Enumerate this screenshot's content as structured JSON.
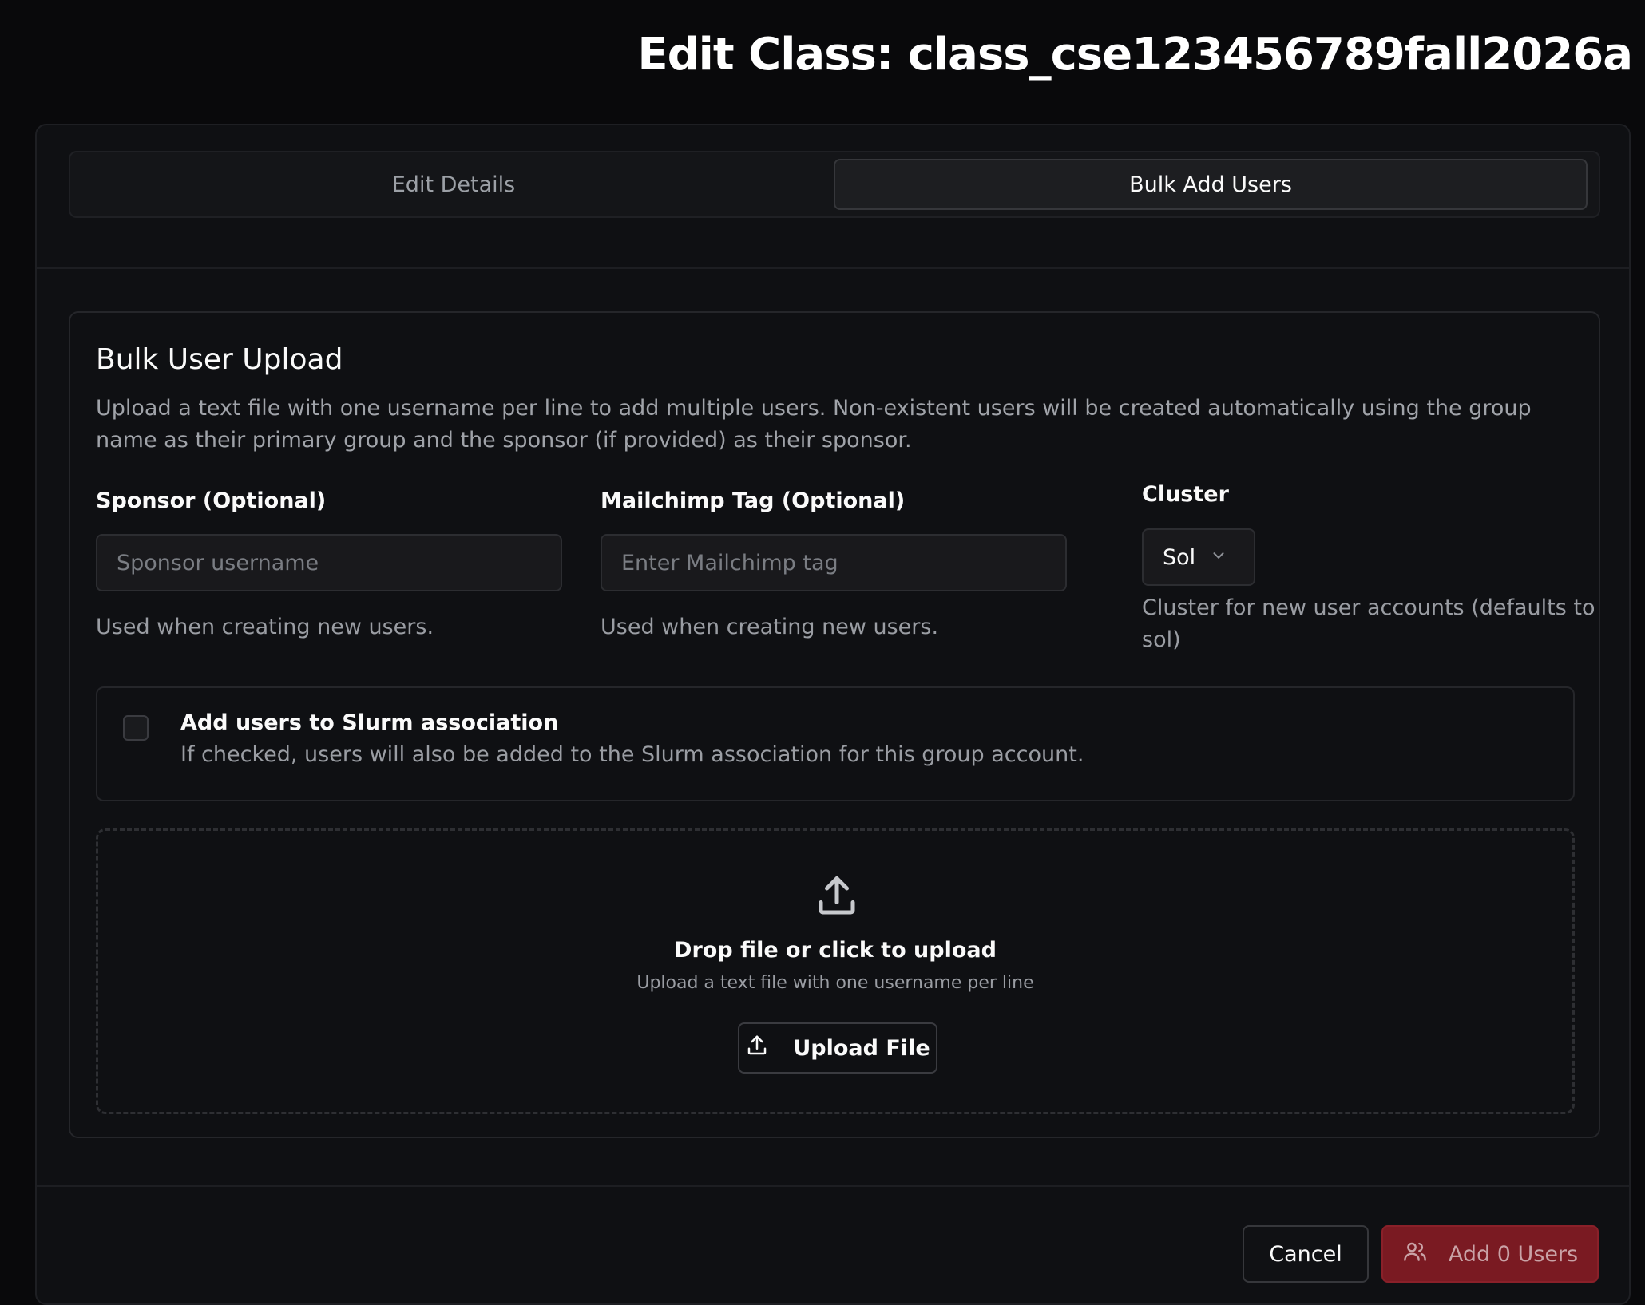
{
  "header": {
    "title": "Edit Class: class_cse123456789fall2026a"
  },
  "tabs": [
    {
      "label": "Edit Details",
      "active": false
    },
    {
      "label": "Bulk Add Users",
      "active": true
    }
  ],
  "bulk_upload": {
    "title": "Bulk User Upload",
    "description": "Upload a text file with one username per line to add multiple users. Non-existent users will be created automatically using the group name as their primary group and the sponsor (if provided) as their sponsor.",
    "sponsor": {
      "label": "Sponsor (Optional)",
      "placeholder": "Sponsor username",
      "value": "",
      "help": "Used when creating new users."
    },
    "mailchimp": {
      "label": "Mailchimp Tag (Optional)",
      "placeholder": "Enter Mailchimp tag",
      "value": "",
      "help": "Used when creating new users."
    },
    "cluster": {
      "label": "Cluster",
      "selected": "Sol",
      "help": "Cluster for new user accounts (defaults to sol)"
    },
    "slurm": {
      "checked": false,
      "label": "Add users to Slurm association",
      "help": "If checked, users will also be added to the Slurm association for this group account."
    },
    "dropzone": {
      "title": "Drop file or click to upload",
      "subtitle": "Upload a text file with one username per line",
      "button_label": "Upload File"
    }
  },
  "footer": {
    "cancel_label": "Cancel",
    "add_label": "Add 0 Users"
  },
  "colors": {
    "background": "#09090b",
    "card": "#0f1013",
    "accent_danger": "#7a1a22"
  }
}
